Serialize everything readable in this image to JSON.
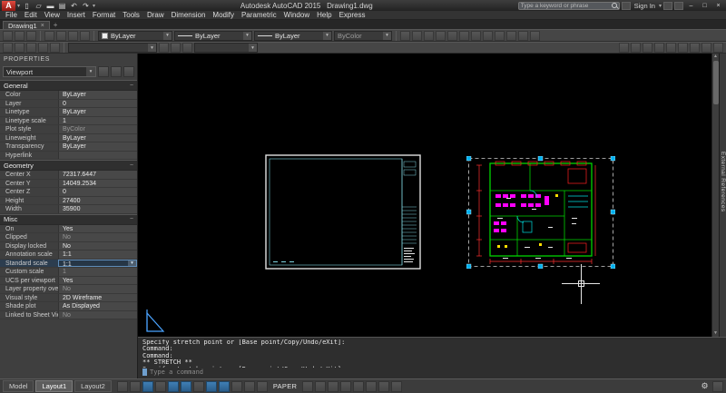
{
  "glyphs": {
    "combo_arrow": "▾",
    "collapse": "−",
    "minimize": "–",
    "maximize": "□",
    "close": "×",
    "doc_close": "×",
    "new_tab": "+",
    "undo": "↶",
    "redo": "↷",
    "new_doc": "▯",
    "open_doc": "▱",
    "save_doc": "▬",
    "plot_doc": "▤",
    "gear": "⚙",
    "scroll_up": "▲",
    "scroll_down": "▼"
  },
  "title_bar": {
    "logo_letter": "A",
    "app_title": "Autodesk AutoCAD 2015",
    "doc_title": "Drawing1.dwg",
    "search_placeholder": "Type a keyword or phrase",
    "sign_in_label": "Sign In"
  },
  "menu_bar": {
    "items": [
      "File",
      "Edit",
      "View",
      "Insert",
      "Format",
      "Tools",
      "Draw",
      "Dimension",
      "Modify",
      "Parametric",
      "Window",
      "Help",
      "Express"
    ]
  },
  "doc_tabs": {
    "active_tab": "Drawing1"
  },
  "toolbar": {
    "color_combo_value": "ByLayer",
    "linetype_combo_value": "ByLayer",
    "lineweight_combo_value": "ByLayer",
    "plot_style_combo_value": "ByColor",
    "row1_left_icons": [
      "layer-properties-icon",
      "layer-states-icon",
      "layer-isolate-icon"
    ],
    "row1_layer_icons": [
      "make-objects-layer-icon",
      "layer-previous-icon",
      "layer-walk-icon",
      "layer-match-icon"
    ],
    "row1_right_icons": [
      "match-properties-icon",
      "copy-icon",
      "mirror-icon",
      "offset-icon",
      "array-icon",
      "move-icon",
      "rotate-icon",
      "scale-icon",
      "trim-icon",
      "fillet-icon",
      "explode-icon",
      "erase-icon"
    ],
    "row2_left_icons": [
      "new-icon",
      "open-icon",
      "save-icon",
      "plot-icon",
      "undo-icon"
    ],
    "row2_mid_icons": [
      "pan-icon",
      "zoom-window-icon",
      "zoom-previous-icon"
    ],
    "row2_right_icons": [
      "draw-line-icon",
      "polyline-icon",
      "circle-icon",
      "arc-icon",
      "rectangle-icon",
      "hatch-icon",
      "text-icon",
      "dimension-icon",
      "table-icon"
    ]
  },
  "properties_palette": {
    "title": "PROPERTIES",
    "object_type": "Viewport",
    "sections": [
      {
        "name": "General",
        "rows": [
          {
            "label": "Color",
            "value": "ByLayer"
          },
          {
            "label": "Layer",
            "value": "0"
          },
          {
            "label": "Linetype",
            "value": "ByLayer"
          },
          {
            "label": "Linetype scale",
            "value": "1"
          },
          {
            "label": "Plot style",
            "value": "ByColor",
            "cls": "muted"
          },
          {
            "label": "Lineweight",
            "value": "ByLayer"
          },
          {
            "label": "Transparency",
            "value": "ByLayer"
          },
          {
            "label": "Hyperlink",
            "value": ""
          }
        ]
      },
      {
        "name": "Geometry",
        "rows": [
          {
            "label": "Center X",
            "value": "72317.6447"
          },
          {
            "label": "Center Y",
            "value": "14049.2534"
          },
          {
            "label": "Center Z",
            "value": "0"
          },
          {
            "label": "Height",
            "value": "27400"
          },
          {
            "label": "Width",
            "value": "35900"
          }
        ]
      },
      {
        "name": "Misc",
        "rows": [
          {
            "label": "On",
            "value": "Yes"
          },
          {
            "label": "Clipped",
            "value": "No",
            "cls": "muted"
          },
          {
            "label": "Display locked",
            "value": "No"
          },
          {
            "label": "Annotation scale",
            "value": "1:1"
          },
          {
            "label": "Standard scale",
            "value": "1:1",
            "cls": "sel-combo"
          },
          {
            "label": "Custom scale",
            "value": "1",
            "cls": "muted"
          },
          {
            "label": "UCS per viewport",
            "value": "Yes"
          },
          {
            "label": "Layer property overrides",
            "value": "No",
            "cls": "muted"
          },
          {
            "label": "Visual style",
            "value": "2D Wireframe"
          },
          {
            "label": "Shade plot",
            "value": "As Displayed"
          },
          {
            "label": "Linked to Sheet View",
            "value": "No",
            "cls": "muted"
          }
        ]
      }
    ]
  },
  "command_line": {
    "history": [
      "Specify stretch point or [Base point/Copy/Undo/eXit]:",
      "Command:",
      "Command:",
      "** STRETCH **",
      "Specify stretch point or [Base point/Copy/Undo/eXit]:"
    ],
    "input_placeholder": "Type a command"
  },
  "status_bar": {
    "layout_tabs": [
      {
        "label": "Model"
      },
      {
        "label": "Layout1",
        "cls": "active"
      },
      {
        "label": "Layout2"
      }
    ],
    "paper_label": "PAPER",
    "left_icons": [
      {
        "n": "infer-constraints-icon"
      },
      {
        "n": "snap-mode-icon"
      },
      {
        "n": "grid-display-icon",
        "cls": "on"
      },
      {
        "n": "ortho-mode-icon"
      },
      {
        "n": "polar-tracking-icon",
        "cls": "on"
      },
      {
        "n": "object-snap-icon",
        "cls": "on"
      },
      {
        "n": "object-snap-tracking-icon"
      },
      {
        "n": "dynamic-ucs-icon",
        "cls": "on"
      },
      {
        "n": "dynamic-input-icon",
        "cls": "on"
      },
      {
        "n": "lineweight-icon"
      },
      {
        "n": "transparency-icon"
      },
      {
        "n": "selection-cycling-icon"
      }
    ],
    "right_icons": [
      {
        "n": "viewport-lock-icon"
      },
      {
        "n": "viewport-scale-icon"
      },
      {
        "n": "annotation-visibility-icon"
      },
      {
        "n": "autoscale-icon"
      },
      {
        "n": "annotation-scale-icon"
      },
      {
        "n": "workspace-switching-icon"
      },
      {
        "n": "annotation-monitor-icon"
      },
      {
        "n": "isolate-objects-icon"
      }
    ]
  },
  "right_edge": {
    "vertical_tab_label": "External References"
  },
  "drawing_colors": {
    "wall_green": "#00d400",
    "detail_red": "#ff2020",
    "furniture_magenta": "#ff00ff",
    "accent_cyan": "#00e0e0",
    "accent_yellow": "#ffe000",
    "grip_blue": "#00b0f0",
    "sheet_border_white": "#e0e0e0",
    "sheet_cyan": "#7fd4df"
  }
}
